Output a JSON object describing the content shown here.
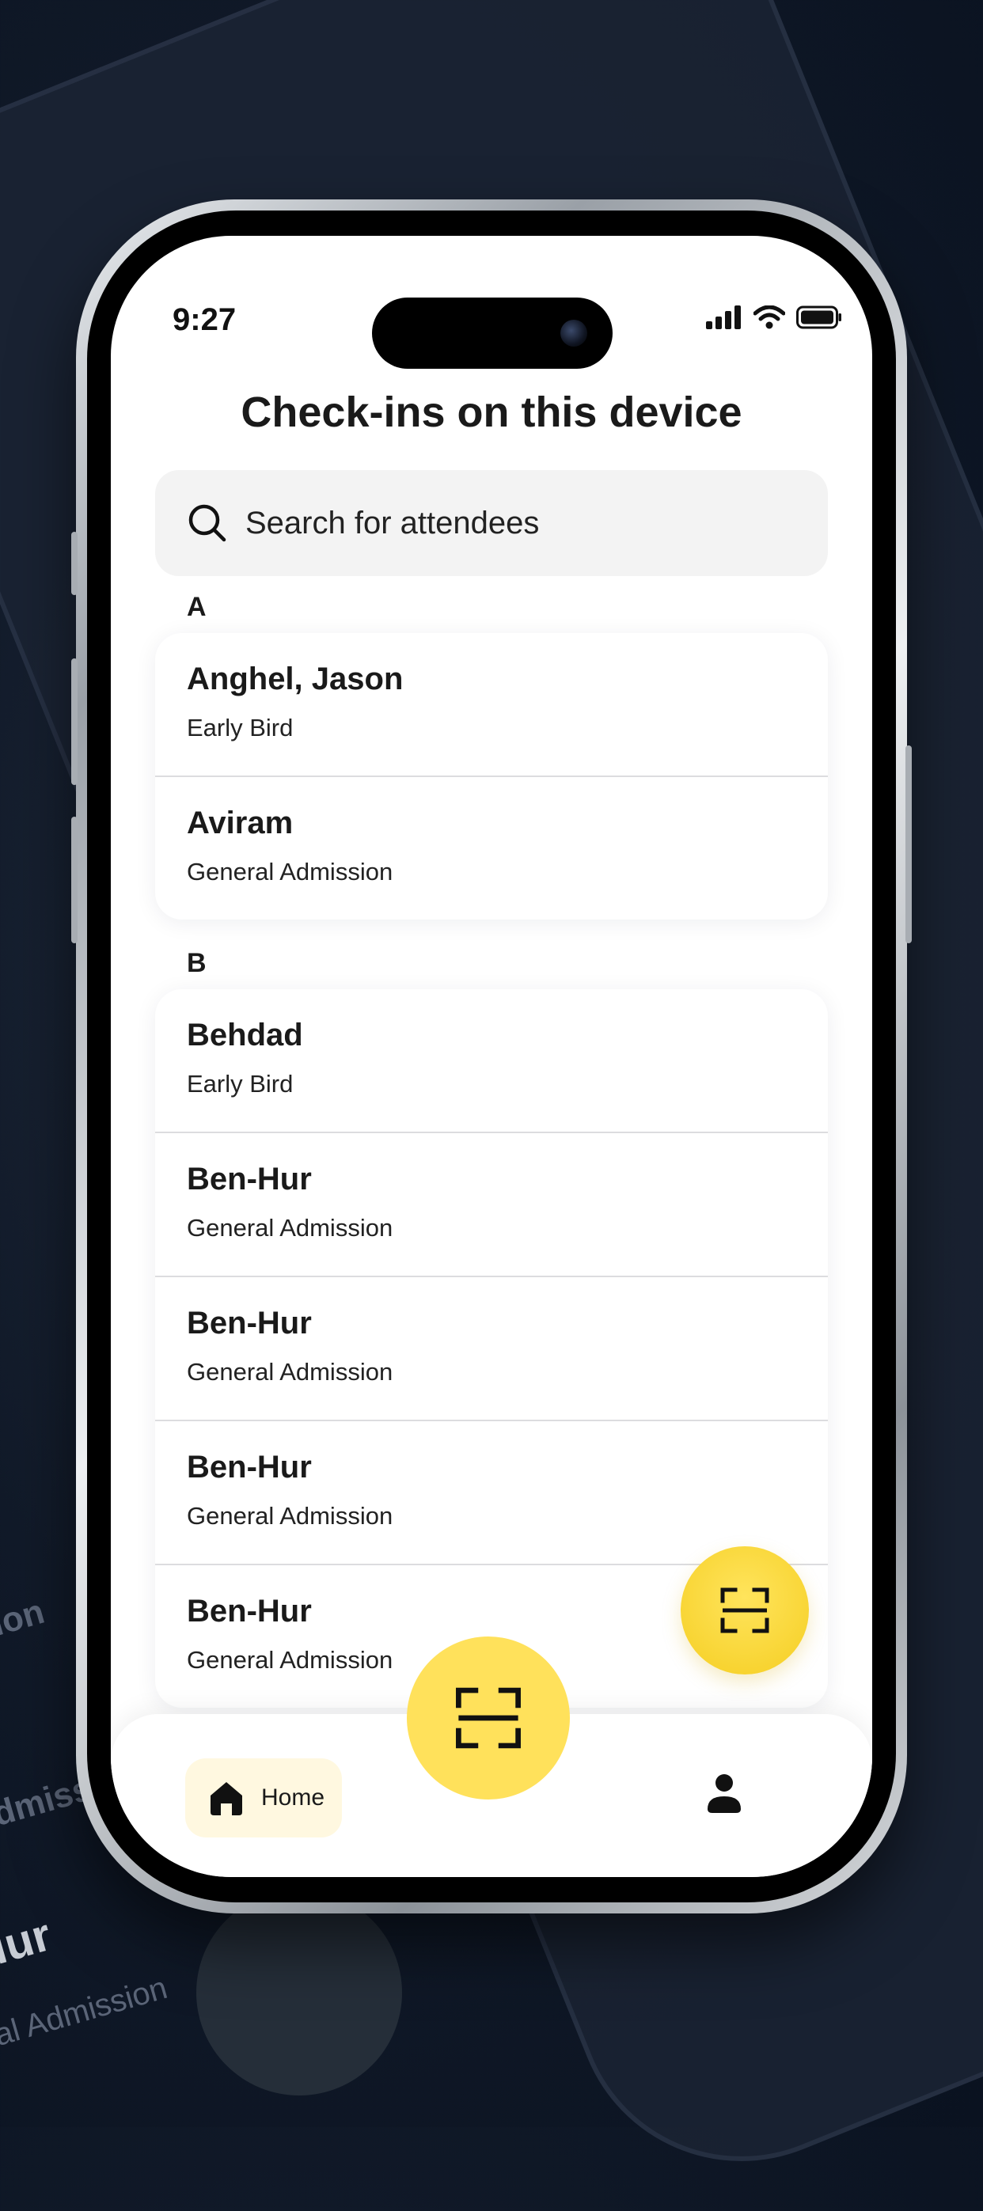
{
  "background": {
    "ghost_texts": [
      "ion",
      "dmissi",
      "lur",
      "al Admission"
    ]
  },
  "status_bar": {
    "time": "9:27"
  },
  "header": {
    "title": "Check-ins on this device"
  },
  "search": {
    "placeholder": "Search for attendees",
    "value": ""
  },
  "sections": [
    {
      "letter": "A",
      "attendees": [
        {
          "name": "Anghel, Jason",
          "ticket": "Early Bird"
        },
        {
          "name": "Aviram",
          "ticket": "General Admission"
        }
      ]
    },
    {
      "letter": "B",
      "attendees": [
        {
          "name": "Behdad",
          "ticket": "Early Bird"
        },
        {
          "name": "Ben-Hur",
          "ticket": "General Admission"
        },
        {
          "name": "Ben-Hur",
          "ticket": "General Admission"
        },
        {
          "name": "Ben-Hur",
          "ticket": "General Admission"
        },
        {
          "name": "Ben-Hur",
          "ticket": "General Admission"
        }
      ]
    }
  ],
  "tab_bar": {
    "home_label": "Home",
    "icons": {
      "home": "home-icon",
      "scan": "scan-icon",
      "profile": "profile-icon"
    }
  },
  "colors": {
    "accent": "#FFE15B",
    "home_tab_bg": "#FFF8E0",
    "text": "#1A1A1A"
  }
}
